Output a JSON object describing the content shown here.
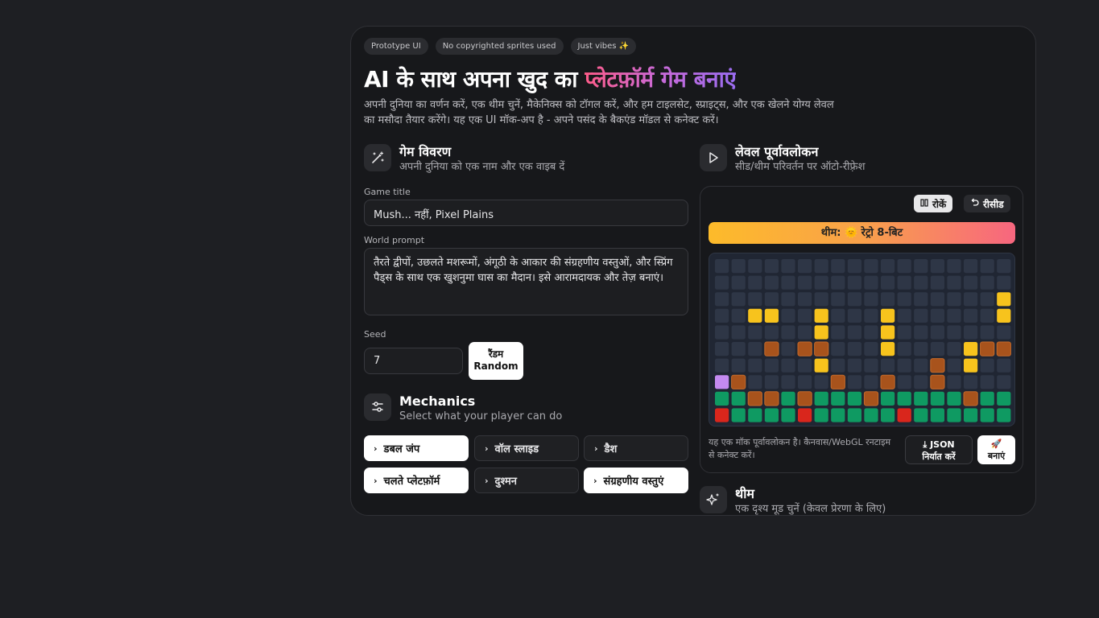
{
  "chips": [
    "Prototype UI",
    "No copyrighted sprites used",
    "Just vibes ✨"
  ],
  "header": {
    "title_plain": "AI के साथ अपना खुद का ",
    "title_accent": "प्लेटफ़ॉर्म गेम बनाएं",
    "subtitle": "अपनी दुनिया का वर्णन करें, एक थीम चुनें, मैकेनिक्स को टॉगल करें, और हम टाइलसेट, स्प्राइट्स, और एक खेलने योग्य लेवल का मसौदा तैयार करेंगे। यह एक UI मॉक-अप है - अपने पसंद के बैकएंड मॉडल से कनेक्ट करें।"
  },
  "description": {
    "title": "गेम विवरण",
    "subtitle": "अपनी दुनिया को एक नाम और एक वाइब दें",
    "game_title_label": "Game title",
    "game_title_value": "Mush... नहीं, Pixel Plains",
    "world_prompt_label": "World prompt",
    "world_prompt_value": "तैरते द्वीपों, उछलते मशरूमों, अंगूठी के आकार की संग्रहणीय वस्तुओं, और स्प्रिंग पैड्स के साथ एक खुशनुमा घास का मैदान। इसे आरामदायक और तेज़ बनाएं।",
    "seed_label": "Seed",
    "seed_value": "7",
    "random_line1": "रैंडम",
    "random_line2": "Random"
  },
  "mechanics": {
    "title": "Mechanics",
    "subtitle": "Select what your player can do",
    "items": [
      {
        "label": "डबल जंप",
        "active": true
      },
      {
        "label": "वॉल स्लाइड",
        "active": false
      },
      {
        "label": "डैश",
        "active": false
      },
      {
        "label": "चलते प्लेटफ़ॉर्म",
        "active": true
      },
      {
        "label": "दुश्मन",
        "active": false
      },
      {
        "label": "संग्रहणीय वस्तुएं",
        "active": true
      }
    ]
  },
  "preview": {
    "title": "लेवल पूर्वावलोकन",
    "subtitle": "सीड/थीम परिवर्तन पर ऑटो-रीफ़्रेश",
    "pause_label": "रोकें",
    "reseed_label": "रीसीड",
    "theme_label": "थीम: 🌞 रेट्रो 8-बिट",
    "note": "यह एक मॉक पूर्वावलोकन है। कैनवास/WebGL रनटाइम से कनेक्ट करें।",
    "export_line1": "JSON",
    "export_line2": "निर्यात करें",
    "build_label": "बनाएं",
    "grid_legend": {
      ".": "empty",
      "Y": "coin",
      "B": "brick",
      "G": "grass",
      "R": "hazard",
      "P": "player"
    },
    "grid": [
      "..................",
      "..................",
      ".................Y",
      "..YY..Y...Y......Y",
      "......Y...Y.......",
      "...B.BB...Y....YBB",
      "......Y......B.Y..",
      "PB.....B..B..B....",
      "GGBBGBGGGBGGGGGBGG",
      "RGGGGRGGGGGRGGGGGG"
    ]
  },
  "theme": {
    "title": "थीम",
    "subtitle": "एक दृश्य मूड चुनें (केवल प्रेरणा के लिए)"
  },
  "colors": {
    "coin": "#f7c31d",
    "brick": "#a8531c",
    "grass": "#0f9a62",
    "hazard": "#d9261c",
    "player": "#c48af0",
    "empty": "#2e3646"
  }
}
